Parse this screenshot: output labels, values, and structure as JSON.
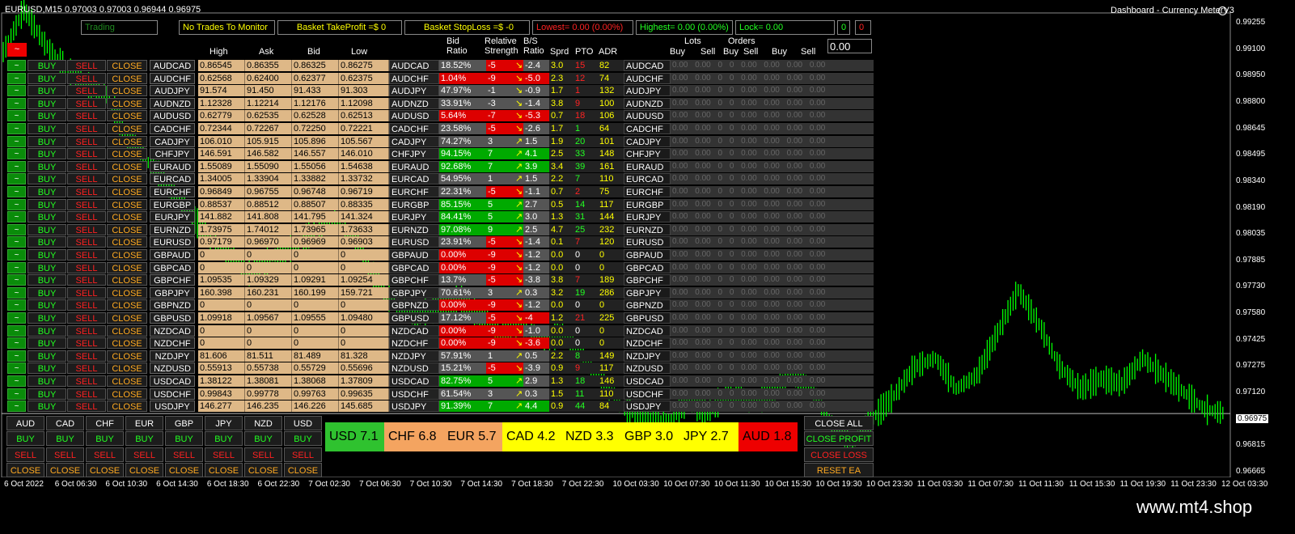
{
  "title": "EURUSD,M15  0.97003 0.97003 0.96944 0.96975",
  "dashboard_label": "Dashboard - Currency MeterV3",
  "status": "Trading",
  "top": {
    "no_trades": "No Trades To Monitor",
    "tp": "Basket TakeProfit =$ 0",
    "sl": "Basket StopLoss =$ -0",
    "lowest": "Lowest= 0.00 (0.00%)",
    "highest": "Highest= 0.00 (0.00%)",
    "lock": "Lock= 0.00",
    "zero": "0",
    "zero2": "0"
  },
  "tilde": "~",
  "lots_value": "0.00",
  "headers": {
    "high": "High",
    "ask": "Ask",
    "bid": "Bid",
    "low": "Low",
    "bid_ratio": "Bid Ratio",
    "rel_str": "Relative Strength",
    "bs_ratio": "B/S Ratio",
    "sprd": "Sprd",
    "pto": "PTO",
    "adr": "ADR",
    "lots": "Lots",
    "orders": "Orders",
    "lots_buy": "Buy",
    "lots_sell": "Sell",
    "orders_buy": "Buy",
    "orders_sell": "Sell",
    "buy": "Buy",
    "sell": "Sell"
  },
  "buttons": {
    "buy": "BUY",
    "sell": "SELL",
    "close": "CLOSE"
  },
  "lots_row": "0.00 0.00 0 0 0.00 0.00 0.00 0.00",
  "rows": [
    {
      "pair": "AUDCAD",
      "high": "0.86545",
      "ask": "0.86355",
      "bid": "0.86325",
      "low": "0.86275",
      "br": "18.52%",
      "brc": "#555",
      "rs": "-5",
      "rsc": "#d00",
      "bs": "-2.4",
      "bsc": "#555",
      "sprd": "3.0",
      "pto": "15",
      "ptoc": "#f22",
      "adr": "82"
    },
    {
      "pair": "AUDCHF",
      "high": "0.62568",
      "ask": "0.62400",
      "bid": "0.62377",
      "low": "0.62375",
      "br": "1.04%",
      "brc": "#d00",
      "rs": "-9",
      "rsc": "#d00",
      "bs": "-5.0",
      "bsc": "#d00",
      "sprd": "2.3",
      "pto": "12",
      "ptoc": "#f22",
      "adr": "74"
    },
    {
      "pair": "AUDJPY",
      "high": "91.574",
      "ask": "91.450",
      "bid": "91.433",
      "low": "91.303",
      "br": "47.97%",
      "brc": "#555",
      "rs": "-1",
      "rsc": "#555",
      "bs": "-0.9",
      "bsc": "#555",
      "sprd": "1.7",
      "pto": "1",
      "ptoc": "#f22",
      "adr": "132"
    },
    {
      "pair": "AUDNZD",
      "high": "1.12328",
      "ask": "1.12214",
      "bid": "1.12176",
      "low": "1.12098",
      "br": "33.91%",
      "brc": "#555",
      "rs": "-3",
      "rsc": "#555",
      "bs": "-1.4",
      "bsc": "#555",
      "sprd": "3.8",
      "pto": "9",
      "ptoc": "#f22",
      "adr": "100"
    },
    {
      "pair": "AUDUSD",
      "high": "0.62779",
      "ask": "0.62535",
      "bid": "0.62528",
      "low": "0.62513",
      "br": "5.64%",
      "brc": "#d00",
      "rs": "-7",
      "rsc": "#d00",
      "bs": "-5.3",
      "bsc": "#d00",
      "sprd": "0.7",
      "pto": "18",
      "ptoc": "#f22",
      "adr": "106"
    },
    {
      "pair": "CADCHF",
      "high": "0.72344",
      "ask": "0.72267",
      "bid": "0.72250",
      "low": "0.72221",
      "br": "23.58%",
      "brc": "#555",
      "rs": "-5",
      "rsc": "#d00",
      "bs": "-2.6",
      "bsc": "#555",
      "sprd": "1.7",
      "pto": "1",
      "ptoc": "#2f2",
      "adr": "64"
    },
    {
      "pair": "CADJPY",
      "high": "106.010",
      "ask": "105.915",
      "bid": "105.896",
      "low": "105.567",
      "br": "74.27%",
      "brc": "#555",
      "rs": "3",
      "rsc": "#555",
      "bs": "1.5",
      "bsc": "#555",
      "sprd": "1.9",
      "pto": "20",
      "ptoc": "#2f2",
      "adr": "101"
    },
    {
      "pair": "CHFJPY",
      "high": "146.591",
      "ask": "146.582",
      "bid": "146.557",
      "low": "146.010",
      "br": "94.15%",
      "brc": "#0a0",
      "rs": "7",
      "rsc": "#0a0",
      "bs": "4.1",
      "bsc": "#0a0",
      "sprd": "2.5",
      "pto": "33",
      "ptoc": "#2f2",
      "adr": "148"
    },
    {
      "pair": "EURAUD",
      "high": "1.55089",
      "ask": "1.55090",
      "bid": "1.55056",
      "low": "1.54638",
      "br": "92.68%",
      "brc": "#0a0",
      "rs": "7",
      "rsc": "#0a0",
      "bs": "3.9",
      "bsc": "#0a0",
      "sprd": "3.4",
      "pto": "39",
      "ptoc": "#2f2",
      "adr": "161"
    },
    {
      "pair": "EURCAD",
      "high": "1.34005",
      "ask": "1.33904",
      "bid": "1.33882",
      "low": "1.33732",
      "br": "54.95%",
      "brc": "#555",
      "rs": "1",
      "rsc": "#555",
      "bs": "1.5",
      "bsc": "#555",
      "sprd": "2.2",
      "pto": "7",
      "ptoc": "#2f2",
      "adr": "110"
    },
    {
      "pair": "EURCHF",
      "high": "0.96849",
      "ask": "0.96755",
      "bid": "0.96748",
      "low": "0.96719",
      "br": "22.31%",
      "brc": "#555",
      "rs": "-5",
      "rsc": "#d00",
      "bs": "-1.1",
      "bsc": "#555",
      "sprd": "0.7",
      "pto": "2",
      "ptoc": "#f22",
      "adr": "75"
    },
    {
      "pair": "EURGBP",
      "high": "0.88537",
      "ask": "0.88512",
      "bid": "0.88507",
      "low": "0.88335",
      "br": "85.15%",
      "brc": "#0a0",
      "rs": "5",
      "rsc": "#0a0",
      "bs": "2.7",
      "bsc": "#555",
      "sprd": "0.5",
      "pto": "14",
      "ptoc": "#2f2",
      "adr": "117"
    },
    {
      "pair": "EURJPY",
      "high": "141.882",
      "ask": "141.808",
      "bid": "141.795",
      "low": "141.324",
      "br": "84.41%",
      "brc": "#0a0",
      "rs": "5",
      "rsc": "#0a0",
      "bs": "3.0",
      "bsc": "#555",
      "sprd": "1.3",
      "pto": "31",
      "ptoc": "#2f2",
      "adr": "144"
    },
    {
      "pair": "EURNZD",
      "high": "1.73975",
      "ask": "1.74012",
      "bid": "1.73965",
      "low": "1.73633",
      "br": "97.08%",
      "brc": "#0a0",
      "rs": "9",
      "rsc": "#0a0",
      "bs": "2.5",
      "bsc": "#555",
      "sprd": "4.7",
      "pto": "25",
      "ptoc": "#2f2",
      "adr": "232"
    },
    {
      "pair": "EURUSD",
      "high": "0.97179",
      "ask": "0.96970",
      "bid": "0.96969",
      "low": "0.96903",
      "br": "23.91%",
      "brc": "#555",
      "rs": "-5",
      "rsc": "#d00",
      "bs": "-1.4",
      "bsc": "#555",
      "sprd": "0.1",
      "pto": "7",
      "ptoc": "#f22",
      "adr": "120"
    },
    {
      "pair": "GBPAUD",
      "high": "0",
      "ask": "0",
      "bid": "0",
      "low": "0",
      "br": "0.00%",
      "brc": "#d00",
      "rs": "-9",
      "rsc": "#d00",
      "bs": "-1.2",
      "bsc": "#555",
      "sprd": "0.0",
      "pto": "0",
      "ptoc": "#fff",
      "adr": "0"
    },
    {
      "pair": "GBPCAD",
      "high": "0",
      "ask": "0",
      "bid": "0",
      "low": "0",
      "br": "0.00%",
      "brc": "#d00",
      "rs": "-9",
      "rsc": "#d00",
      "bs": "-1.2",
      "bsc": "#555",
      "sprd": "0.0",
      "pto": "0",
      "ptoc": "#fff",
      "adr": "0"
    },
    {
      "pair": "GBPCHF",
      "high": "1.09535",
      "ask": "1.09329",
      "bid": "1.09291",
      "low": "1.09254",
      "br": "13.7%",
      "brc": "#555",
      "rs": "-5",
      "rsc": "#d00",
      "bs": "-3.8",
      "bsc": "#555",
      "sprd": "3.8",
      "pto": "7",
      "ptoc": "#f22",
      "adr": "189"
    },
    {
      "pair": "GBPJPY",
      "high": "160.398",
      "ask": "160.231",
      "bid": "160.199",
      "low": "159.721",
      "br": "70.61%",
      "brc": "#555",
      "rs": "3",
      "rsc": "#555",
      "bs": "0.3",
      "bsc": "#555",
      "sprd": "3.2",
      "pto": "19",
      "ptoc": "#2f2",
      "adr": "286"
    },
    {
      "pair": "GBPNZD",
      "high": "0",
      "ask": "0",
      "bid": "0",
      "low": "0",
      "br": "0.00%",
      "brc": "#d00",
      "rs": "-9",
      "rsc": "#d00",
      "bs": "-1.2",
      "bsc": "#555",
      "sprd": "0.0",
      "pto": "0",
      "ptoc": "#fff",
      "adr": "0"
    },
    {
      "pair": "GBPUSD",
      "high": "1.09918",
      "ask": "1.09567",
      "bid": "1.09555",
      "low": "1.09480",
      "br": "17.12%",
      "brc": "#555",
      "rs": "-5",
      "rsc": "#d00",
      "bs": "-4",
      "bsc": "#d00",
      "sprd": "1.2",
      "pto": "21",
      "ptoc": "#f22",
      "adr": "225"
    },
    {
      "pair": "NZDCAD",
      "high": "0",
      "ask": "0",
      "bid": "0",
      "low": "0",
      "br": "0.00%",
      "brc": "#d00",
      "rs": "-9",
      "rsc": "#d00",
      "bs": "-1.0",
      "bsc": "#555",
      "sprd": "0.0",
      "pto": "0",
      "ptoc": "#fff",
      "adr": "0"
    },
    {
      "pair": "NZDCHF",
      "high": "0",
      "ask": "0",
      "bid": "0",
      "low": "0",
      "br": "0.00%",
      "brc": "#d00",
      "rs": "-9",
      "rsc": "#d00",
      "bs": "-3.6",
      "bsc": "#d00",
      "sprd": "0.0",
      "pto": "0",
      "ptoc": "#fff",
      "adr": "0"
    },
    {
      "pair": "NZDJPY",
      "high": "81.606",
      "ask": "81.511",
      "bid": "81.489",
      "low": "81.328",
      "br": "57.91%",
      "brc": "#555",
      "rs": "1",
      "rsc": "#555",
      "bs": "0.5",
      "bsc": "#555",
      "sprd": "2.2",
      "pto": "8",
      "ptoc": "#2f2",
      "adr": "149"
    },
    {
      "pair": "NZDUSD",
      "high": "0.55913",
      "ask": "0.55738",
      "bid": "0.55729",
      "low": "0.55696",
      "br": "15.21%",
      "brc": "#555",
      "rs": "-5",
      "rsc": "#d00",
      "bs": "-3.9",
      "bsc": "#555",
      "sprd": "0.9",
      "pto": "9",
      "ptoc": "#f22",
      "adr": "117"
    },
    {
      "pair": "USDCAD",
      "high": "1.38122",
      "ask": "1.38081",
      "bid": "1.38068",
      "low": "1.37809",
      "br": "82.75%",
      "brc": "#0a0",
      "rs": "5",
      "rsc": "#0a0",
      "bs": "2.9",
      "bsc": "#555",
      "sprd": "1.3",
      "pto": "18",
      "ptoc": "#2f2",
      "adr": "146"
    },
    {
      "pair": "USDCHF",
      "high": "0.99843",
      "ask": "0.99778",
      "bid": "0.99763",
      "low": "0.99635",
      "br": "61.54%",
      "brc": "#555",
      "rs": "3",
      "rsc": "#555",
      "bs": "0.3",
      "bsc": "#555",
      "sprd": "1.5",
      "pto": "11",
      "ptoc": "#2f2",
      "adr": "110"
    },
    {
      "pair": "USDJPY",
      "high": "146.277",
      "ask": "146.235",
      "bid": "146.226",
      "low": "145.685",
      "br": "91.39%",
      "brc": "#0a0",
      "rs": "7",
      "rsc": "#0a0",
      "bs": "4.4",
      "bsc": "#0a0",
      "sprd": "0.9",
      "pto": "44",
      "ptoc": "#2f2",
      "adr": "84"
    }
  ],
  "currencies": [
    "AUD",
    "CAD",
    "CHF",
    "EUR",
    "GBP",
    "JPY",
    "NZD",
    "USD"
  ],
  "strength": [
    {
      "label": "USD 7.1",
      "color": "#2fc22f"
    },
    {
      "label": "CHF 6.8",
      "color": "#f4a460"
    },
    {
      "label": "EUR 5.7",
      "color": "#f4a460"
    },
    {
      "label": "CAD 4.2",
      "color": "#ffff00"
    },
    {
      "label": "NZD 3.3",
      "color": "#ffff00"
    },
    {
      "label": "GBP 3.0",
      "color": "#ffff00"
    },
    {
      "label": "JPY 2.7",
      "color": "#ffff00"
    },
    {
      "label": "AUD 1.8",
      "color": "#ee0000"
    }
  ],
  "right_buttons": {
    "close_all": "CLOSE ALL",
    "close_profit": "CLOSE PROFIT",
    "close_loss": "CLOSE LOSS",
    "reset": "RESET EA"
  },
  "y_labels": [
    "0.99255",
    "0.99100",
    "0.98950",
    "0.98800",
    "0.98645",
    "0.98495",
    "0.98340",
    "0.98190",
    "0.98035",
    "0.97885",
    "0.97730",
    "0.97580",
    "0.97425",
    "0.97275",
    "0.97120",
    "0.96975",
    "0.96815",
    "0.96665"
  ],
  "x_labels": [
    "6 Oct 2022",
    "6 Oct 06:30",
    "6 Oct 10:30",
    "6 Oct 14:30",
    "6 Oct 18:30",
    "6 Oct 22:30",
    "7 Oct 02:30",
    "7 Oct 06:30",
    "7 Oct 10:30",
    "7 Oct 14:30",
    "7 Oct 18:30",
    "7 Oct 22:30",
    "10 Oct 03:30",
    "10 Oct 07:30",
    "10 Oct 11:30",
    "10 Oct 15:30",
    "10 Oct 19:30",
    "10 Oct 23:30",
    "11 Oct 03:30",
    "11 Oct 07:30",
    "11 Oct 11:30",
    "11 Oct 15:30",
    "11 Oct 19:30",
    "11 Oct 23:30",
    "12 Oct 03:30"
  ],
  "price_path": [
    0.991,
    0.9935,
    0.9915,
    0.99,
    0.989,
    0.9885,
    0.986,
    0.9845,
    0.983,
    0.9815,
    0.98,
    0.979,
    0.978,
    0.979,
    0.9795,
    0.9805,
    0.981,
    0.98,
    0.9775,
    0.976,
    0.9755,
    0.976,
    0.9765,
    0.9755,
    0.9745,
    0.975,
    0.974,
    0.9745,
    0.973,
    0.9715,
    0.97,
    0.9695,
    0.969,
    0.9705,
    0.9698,
    0.971,
    0.9705,
    0.9708,
    0.972,
    0.9712,
    0.969,
    0.968,
    0.9695,
    0.9708,
    0.9725,
    0.973,
    0.9712,
    0.972,
    0.9745,
    0.977,
    0.975,
    0.9725,
    0.9712,
    0.9718,
    0.9715,
    0.973,
    0.972,
    0.971,
    0.97,
    0.96975
  ],
  "watermark": "www.mt4.shop",
  "colors": {
    "green": "#00ff00",
    "tan": "#deb887",
    "up": "#2fc22f",
    "down": "#ee0000"
  }
}
